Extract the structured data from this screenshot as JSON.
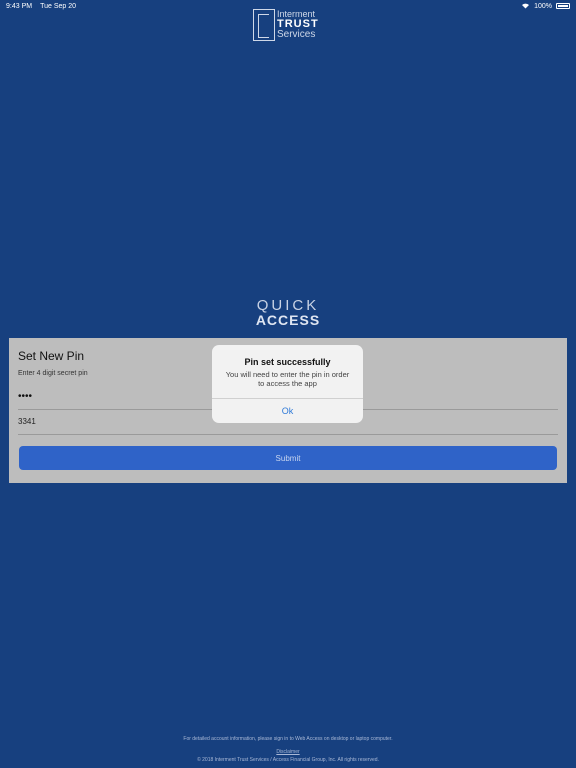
{
  "status_bar": {
    "time": "9:43 PM",
    "date": "Tue Sep 20",
    "battery": "100%"
  },
  "logo": {
    "line1": "Interment",
    "line2": "TRUST",
    "line3": "Services"
  },
  "brand": {
    "quick": "QUICK",
    "access": "ACCESS"
  },
  "form": {
    "title": "Set New Pin",
    "hint": "Enter 4 digit secret pin",
    "pin_value": "••••",
    "confirm_value": "3341",
    "submit_label": "Submit"
  },
  "alert": {
    "title": "Pin set successfully",
    "message": "You will need to enter the pin in order to access the app",
    "ok_label": "Ok"
  },
  "footer": {
    "info": "For detailed account information, please sign in to Web Access on desktop or laptop computer.",
    "disclaimer": "Disclaimer",
    "copyright": "© 2018 Interment Trust Services / Access Financial Group, Inc. All rights reserved."
  },
  "colors": {
    "background": "#17407f",
    "panel": "#bdbdbd",
    "submit": "#2f63c8",
    "alert_button": "#2f7ad8"
  }
}
